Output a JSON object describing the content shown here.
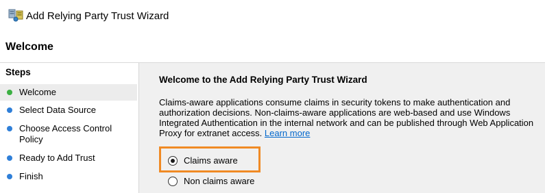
{
  "window": {
    "title": "Add Relying Party Trust Wizard",
    "icon": "server-trust-icon"
  },
  "page": {
    "heading": "Welcome"
  },
  "sidebar": {
    "title": "Steps",
    "items": [
      {
        "label": "Welcome",
        "state": "current",
        "dot_color": "#3cb043"
      },
      {
        "label": "Select Data Source",
        "state": "pending",
        "dot_color": "#2f7fd8"
      },
      {
        "label": "Choose Access Control Policy",
        "state": "pending",
        "dot_color": "#2f7fd8"
      },
      {
        "label": "Ready to Add Trust",
        "state": "pending",
        "dot_color": "#2f7fd8"
      },
      {
        "label": "Finish",
        "state": "pending",
        "dot_color": "#2f7fd8"
      }
    ]
  },
  "content": {
    "title": "Welcome to the Add Relying Party Trust Wizard",
    "description": "Claims-aware applications consume claims in security tokens to make authentication and authorization decisions. Non-claims-aware applications are web-based and use Windows Integrated Authentication in the internal network and can be published through Web Application Proxy for extranet access.",
    "learn_more": "Learn more",
    "options": [
      {
        "label": "Claims aware",
        "selected": true
      },
      {
        "label": "Non claims aware",
        "selected": false
      }
    ]
  },
  "colors": {
    "highlight": "#f08a24",
    "link": "#0066cc",
    "content_bg": "#f0f0f0"
  }
}
